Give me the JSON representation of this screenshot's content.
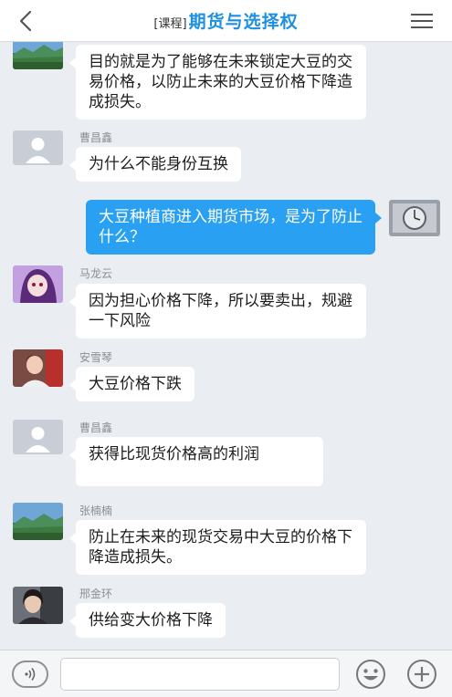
{
  "header": {
    "tag": "[课程]",
    "title": "期货与选择权",
    "back_icon": "chevron-left-icon",
    "menu_icon": "hamburger-menu-icon"
  },
  "messages": [
    {
      "sender": "",
      "text": "目的就是为了能够在未来锁定大豆的交易价格，以防止未来的大豆价格下降造成损失。",
      "avatar": "landscape-avatar"
    },
    {
      "sender": "曹昌鑫",
      "text": "为什么不能身份互换",
      "avatar": "default-user-avatar"
    },
    {
      "sender": "",
      "text": "大豆种植商进入期货市场，是为了防止什么？",
      "avatar": "watch-avatar",
      "self": true
    },
    {
      "sender": "马龙云",
      "text": "因为担心价格下降，所以要卖出，规避一下风险",
      "avatar": "anime-avatar"
    },
    {
      "sender": "安雪琴",
      "text": "大豆价格下跌",
      "avatar": "person-avatar"
    },
    {
      "sender": "曹昌鑫",
      "text": "获得比现货价格高的利润",
      "avatar": "default-user-avatar"
    },
    {
      "sender": "张楠楠",
      "text": "防止在未来的现货交易中大豆的价格下降造成损失。",
      "avatar": "landscape-avatar"
    },
    {
      "sender": "邢金环",
      "text": "供给变大价格下降",
      "avatar": "photo-avatar"
    }
  ],
  "footer": {
    "input_value": "",
    "input_placeholder": "",
    "voice_icon": "voice-icon",
    "emoji_icon": "emoji-icon",
    "add_icon": "plus-circle-icon"
  },
  "colors": {
    "accent": "#1e8fe1",
    "self_bubble": "#2aa0f2",
    "background": "#eaedf2"
  }
}
